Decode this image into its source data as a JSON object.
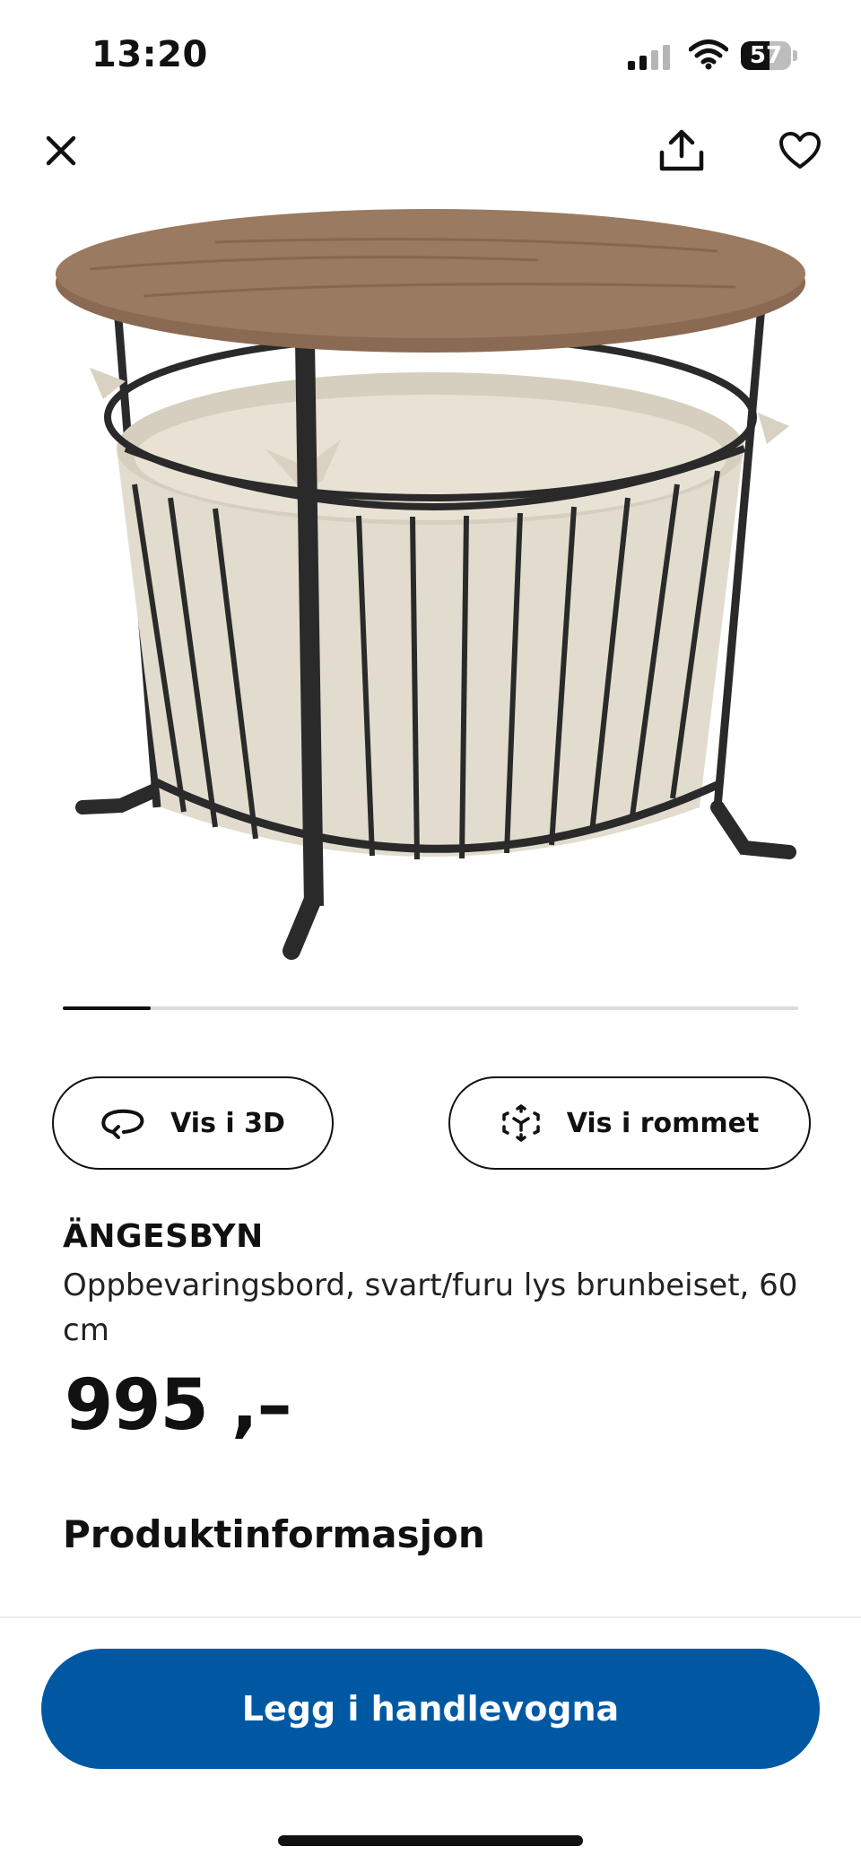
{
  "status_bar": {
    "time": "13:20",
    "battery_level": "57",
    "icons": [
      "cellular-signal-icon",
      "wifi-icon",
      "battery-icon"
    ]
  },
  "nav": {
    "icons": [
      "close-icon",
      "share-icon",
      "heart-icon"
    ]
  },
  "product_image": {
    "icon": "product-photo",
    "carousel_progress": 0.12
  },
  "actions": {
    "view_3d_label": "Vis i 3D",
    "view_room_label": "Vis i rommet",
    "icons": [
      "rotate-3d-icon",
      "ar-cube-icon"
    ]
  },
  "product": {
    "name": "ÄNGESBYN",
    "description": "Oppbevaringsbord, svart/furu lys brunbeiset, 60 cm",
    "price": "995 ,–"
  },
  "sections": {
    "product_info": "Produktinformasjon"
  },
  "cart": {
    "button_label": "Legg i handlevogna"
  },
  "colors": {
    "primary_blue": "#0058a3",
    "text": "#111111"
  }
}
